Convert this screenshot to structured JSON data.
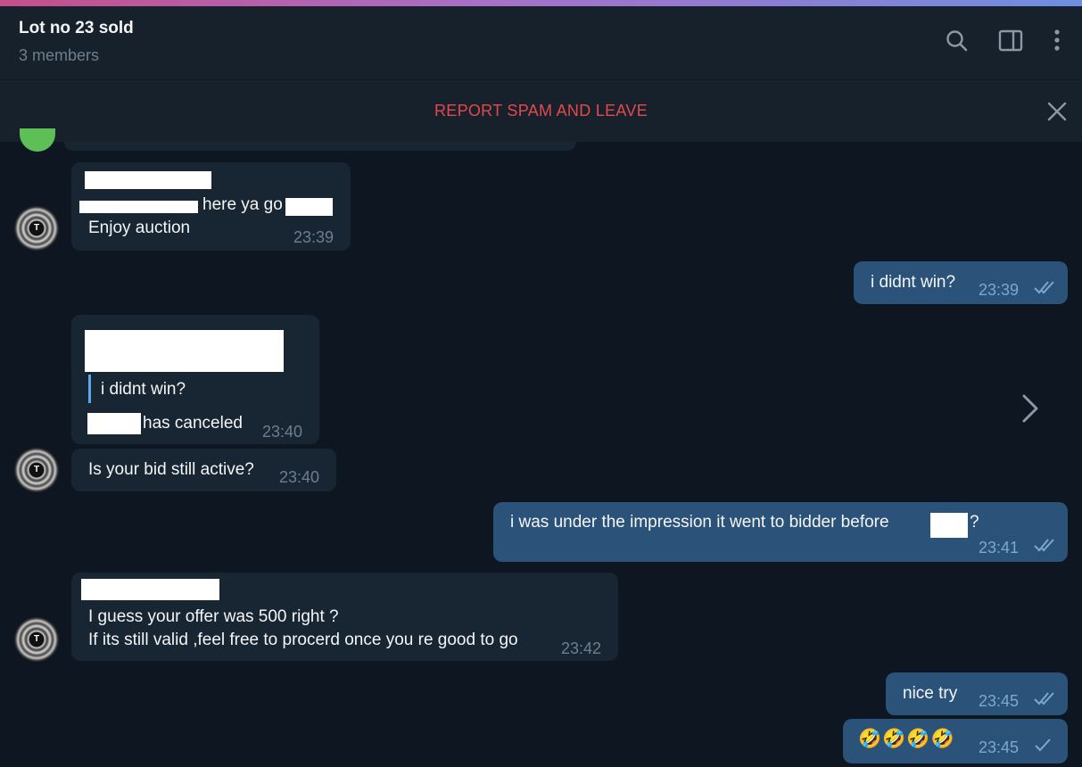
{
  "header": {
    "title": "Lot no 23 sold",
    "subtitle": "3 members",
    "icons": [
      "search-icon",
      "sidebar-toggle-icon",
      "more-vertical-icon"
    ]
  },
  "spam_bar": {
    "label": "REPORT SPAM AND LEAVE",
    "close_icon": "close-icon",
    "color": "#e5484d"
  },
  "colors": {
    "background": "#0e1621",
    "incoming_bubble": "#182533",
    "outgoing_bubble": "#2b5278",
    "accent": "#5fa8e8"
  },
  "messages": [
    {
      "direction": "in",
      "lines": [
        "here ya go",
        "Enjoy auction"
      ],
      "time": "23:39"
    },
    {
      "direction": "out",
      "text": "i didnt win?",
      "time": "23:39",
      "status": "read"
    },
    {
      "direction": "in",
      "quote": "i didnt win?",
      "text": "has canceled",
      "time": "23:40"
    },
    {
      "direction": "in",
      "text": "Is your bid still active?",
      "time": "23:40"
    },
    {
      "direction": "out",
      "text_before": "i was under the impression it went to bidder before",
      "text_after": "?",
      "time": "23:41",
      "status": "read"
    },
    {
      "direction": "in",
      "lines": [
        "I guess your offer was 500 right ?",
        "If its still valid ,feel free to procerd once you re good to go"
      ],
      "time": "23:42"
    },
    {
      "direction": "out",
      "text": "nice try",
      "time": "23:45",
      "status": "read"
    },
    {
      "direction": "out",
      "text": "🤣🤣🤣🤣",
      "time": "23:45",
      "status": "sent"
    }
  ]
}
